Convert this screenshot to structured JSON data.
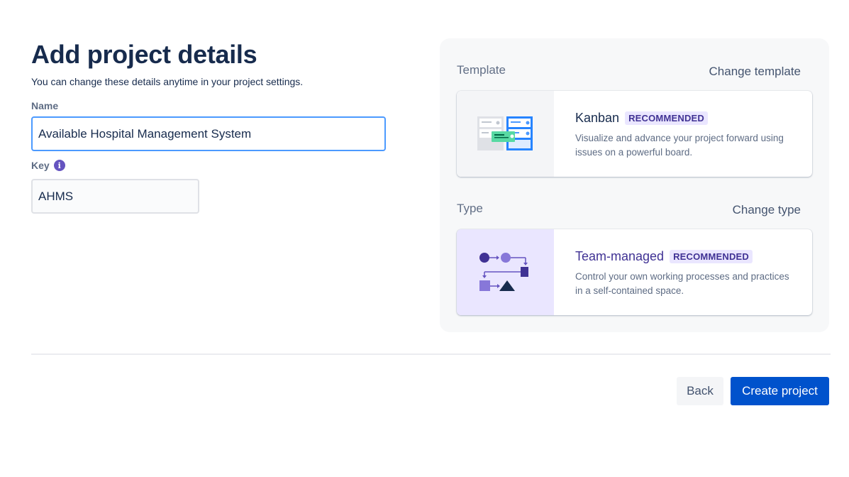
{
  "page": {
    "title": "Add project details",
    "subtitle": "You can change these details anytime in your project settings."
  },
  "form": {
    "name_label": "Name",
    "name_value": "Available Hospital Management System",
    "key_label": "Key",
    "key_value": "AHMS",
    "info_glyph": "i"
  },
  "template": {
    "section_label": "Template",
    "change_label": "Change template",
    "card": {
      "title": "Kanban",
      "badge": "RECOMMENDED",
      "description": "Visualize and advance your project forward using issues on a powerful board.",
      "icon": "kanban-board-illustration"
    }
  },
  "type": {
    "section_label": "Type",
    "change_label": "Change type",
    "card": {
      "title": "Team-managed",
      "badge": "RECOMMENDED",
      "description": "Control your own working processes and practices in a self-contained space.",
      "icon": "team-managed-illustration"
    }
  },
  "actions": {
    "back_label": "Back",
    "create_label": "Create project"
  },
  "colors": {
    "primary": "#0052cc",
    "focus_border": "#4c9aff",
    "badge_bg": "#eae6ff",
    "badge_text": "#403294",
    "info_icon": "#6554c0"
  }
}
